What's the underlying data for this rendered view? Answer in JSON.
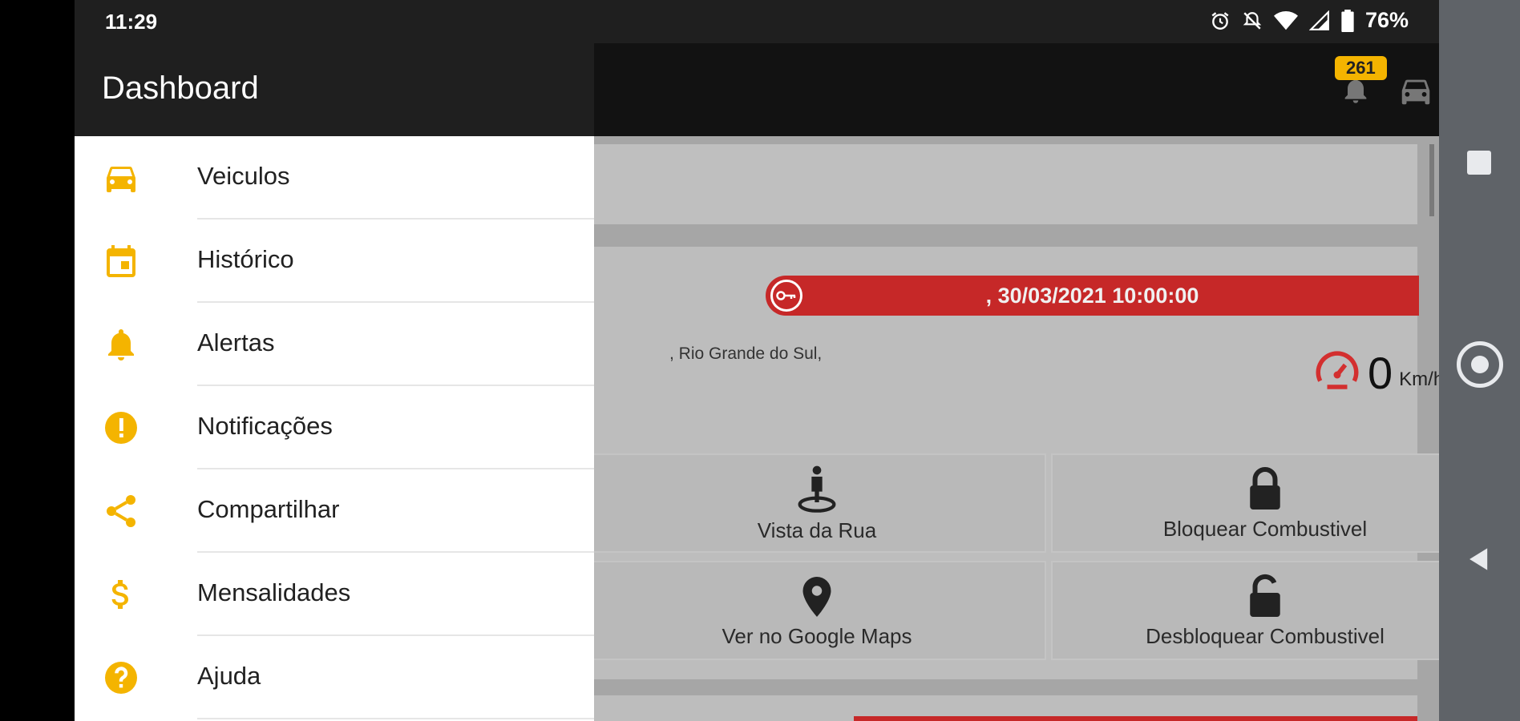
{
  "status_bar": {
    "time": "11:29",
    "battery": "76%",
    "icons": [
      "alarm-icon",
      "notifications-off-icon",
      "wifi-icon",
      "signal-icon",
      "battery-icon"
    ]
  },
  "app_bar": {
    "notification_count": "261",
    "actions": [
      "bell-icon",
      "car-icon",
      "refresh-icon"
    ]
  },
  "drawer": {
    "title": "Dashboard",
    "accent": "#f4b400",
    "items": [
      {
        "label": "Veiculos",
        "icon": "car-icon"
      },
      {
        "label": "Histórico",
        "icon": "calendar-icon"
      },
      {
        "label": "Alertas",
        "icon": "bell-icon"
      },
      {
        "label": "Notificações",
        "icon": "alert-circle-icon"
      },
      {
        "label": "Compartilhar",
        "icon": "share-icon"
      },
      {
        "label": "Mensalidades",
        "icon": "dollar-icon"
      },
      {
        "label": "Ajuda",
        "icon": "help-icon"
      }
    ]
  },
  "vehicle_card": {
    "timestamp": ", 30/03/2021 10:00:00",
    "address": ", Rio Grande do Sul,",
    "speed_value": "0",
    "speed_unit": "Km/h",
    "status_color": "#c62828",
    "actions": {
      "street_view": "Vista da Rua",
      "block_fuel": "Bloquear Combustivel",
      "google_maps": "Ver no Google Maps",
      "unblock_fuel": "Desbloquear Combustivel"
    }
  }
}
